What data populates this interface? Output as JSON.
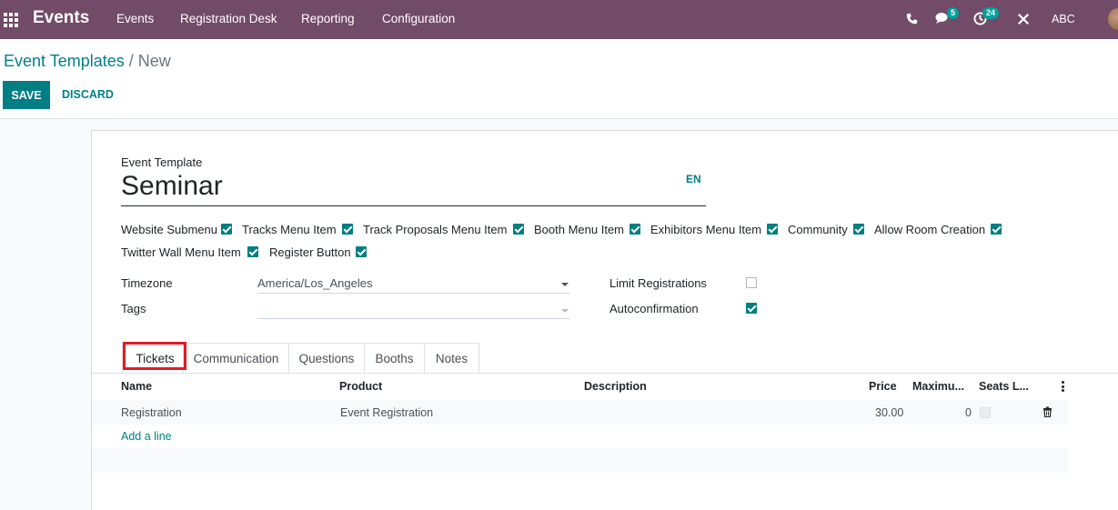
{
  "navbar": {
    "brand": "Events",
    "menu": [
      "Events",
      "Registration Desk",
      "Reporting",
      "Configuration"
    ],
    "chat_badge": "5",
    "activity_badge": "24",
    "company": "ABC"
  },
  "breadcrumb": {
    "parent": "Event Templates",
    "separator": "/",
    "current": "New"
  },
  "buttons": {
    "save": "SAVE",
    "discard": "DISCARD"
  },
  "form": {
    "title_label": "Event Template",
    "title_value": "Seminar",
    "lang": "EN",
    "menu_checks": [
      {
        "label": "Website Submenu",
        "checked": true
      },
      {
        "label": "Tracks Menu Item",
        "checked": true
      },
      {
        "label": "Track Proposals Menu Item",
        "checked": true
      },
      {
        "label": "Booth Menu Item",
        "checked": true
      },
      {
        "label": "Exhibitors Menu Item",
        "checked": true
      },
      {
        "label": "Community",
        "checked": true
      },
      {
        "label": "Allow Room Creation",
        "checked": true
      },
      {
        "label": "Twitter Wall Menu Item",
        "checked": true
      },
      {
        "label": "Register Button",
        "checked": true
      }
    ],
    "timezone_label": "Timezone",
    "timezone_value": "America/Los_Angeles",
    "tags_label": "Tags",
    "tags_value": "",
    "limit_label": "Limit Registrations",
    "limit_checked": false,
    "autoconf_label": "Autoconfirmation",
    "autoconf_checked": true
  },
  "tabs": [
    "Tickets",
    "Communication",
    "Questions",
    "Booths",
    "Notes"
  ],
  "active_tab": "Tickets",
  "table": {
    "headers": [
      "Name",
      "Product",
      "Description",
      "Price",
      "Maximu...",
      "Seats L..."
    ],
    "rows": [
      {
        "name": "Registration",
        "product": "Event Registration",
        "description": "",
        "price": "30.00",
        "maximum": "0",
        "seats_limited": false
      }
    ],
    "add_line": "Add a line"
  },
  "colors": {
    "navbar": "#714B67",
    "accent": "#017e84",
    "highlight": "#e01b24"
  }
}
